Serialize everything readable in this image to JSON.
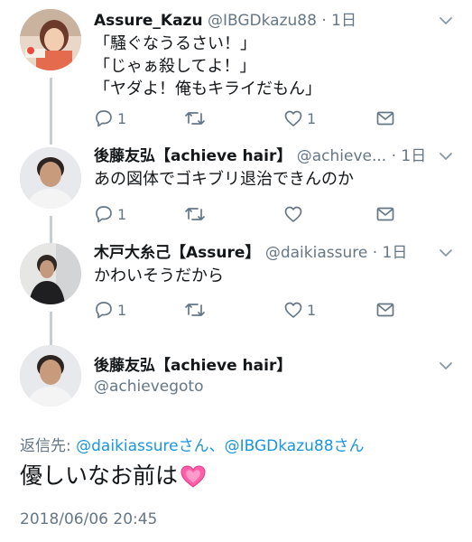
{
  "tweets": [
    {
      "name": "Assure_Kazu",
      "handle": "@IBGDkazu88",
      "dot": "·",
      "time": "1日",
      "lines": [
        "「騒ぐなうるさい！」",
        "「じゃぁ殺してよ！」",
        "「ヤダよ！俺もキライだもん」"
      ],
      "reply_count": "1",
      "retweet_count": "",
      "like_count": "1"
    },
    {
      "name": "後藤友弘【achieve hair】",
      "handle": "@achieve...",
      "dot": "·",
      "time": "1日",
      "lines": [
        "あの図体でゴキブリ退治できんのか"
      ],
      "reply_count": "1",
      "retweet_count": "",
      "like_count": ""
    },
    {
      "name": "木戸大糸己【Assure】",
      "handle": "@daikiassure",
      "dot": "·",
      "time": "1日",
      "lines": [
        "かわいそうだから"
      ],
      "reply_count": "1",
      "retweet_count": "",
      "like_count": "1"
    }
  ],
  "focused": {
    "name": "後藤友弘【achieve hair】",
    "handle": "@achievegoto",
    "reply_label": "返信先:",
    "reply_handle_1": "@daikiassureさん",
    "reply_sep": "、",
    "reply_handle_2": "@IBGDkazu88さん",
    "text": "優しいなお前は",
    "emoji": "heart-icon",
    "timestamp": "2018/06/06 20:45"
  },
  "colors": {
    "link": "#1b95e0",
    "meta": "#657786",
    "heart": "#ff5fa8"
  }
}
